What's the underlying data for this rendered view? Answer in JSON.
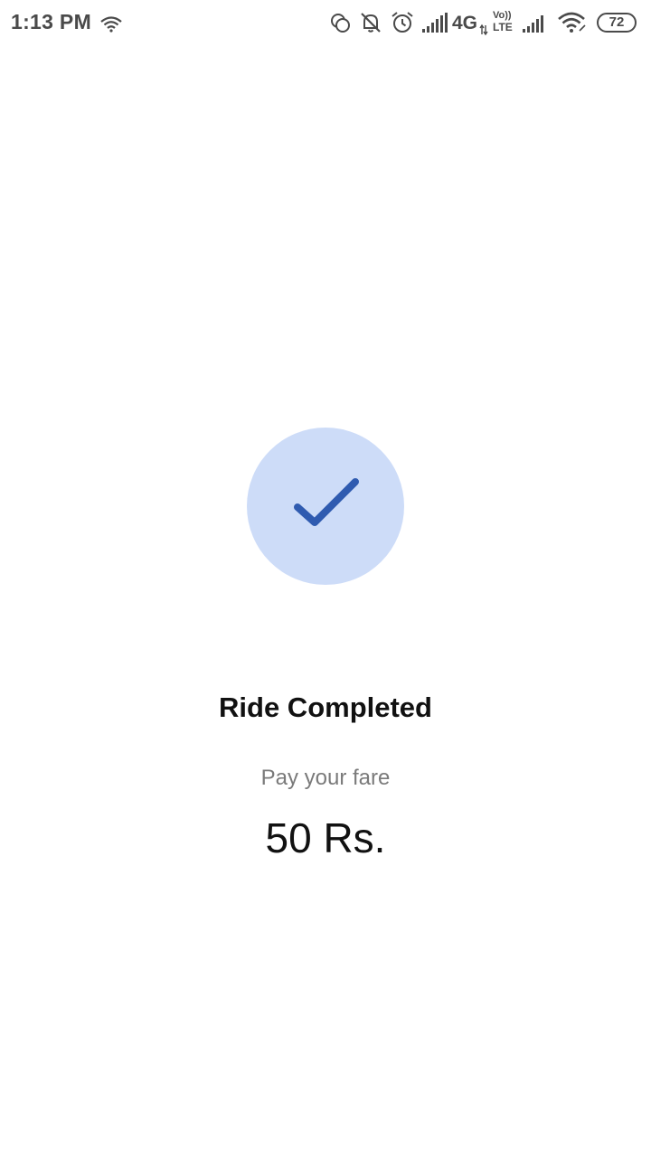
{
  "status_bar": {
    "time": "1:13 PM",
    "network_label": "4G",
    "volte_top": "Vo))",
    "volte_bottom": "LTE",
    "battery_level": "72"
  },
  "main": {
    "title": "Ride Completed",
    "subtitle": "Pay your fare",
    "fare": "50 Rs."
  },
  "colors": {
    "check_circle_bg": "#cddcf8",
    "check_mark": "#2f5bb0"
  }
}
